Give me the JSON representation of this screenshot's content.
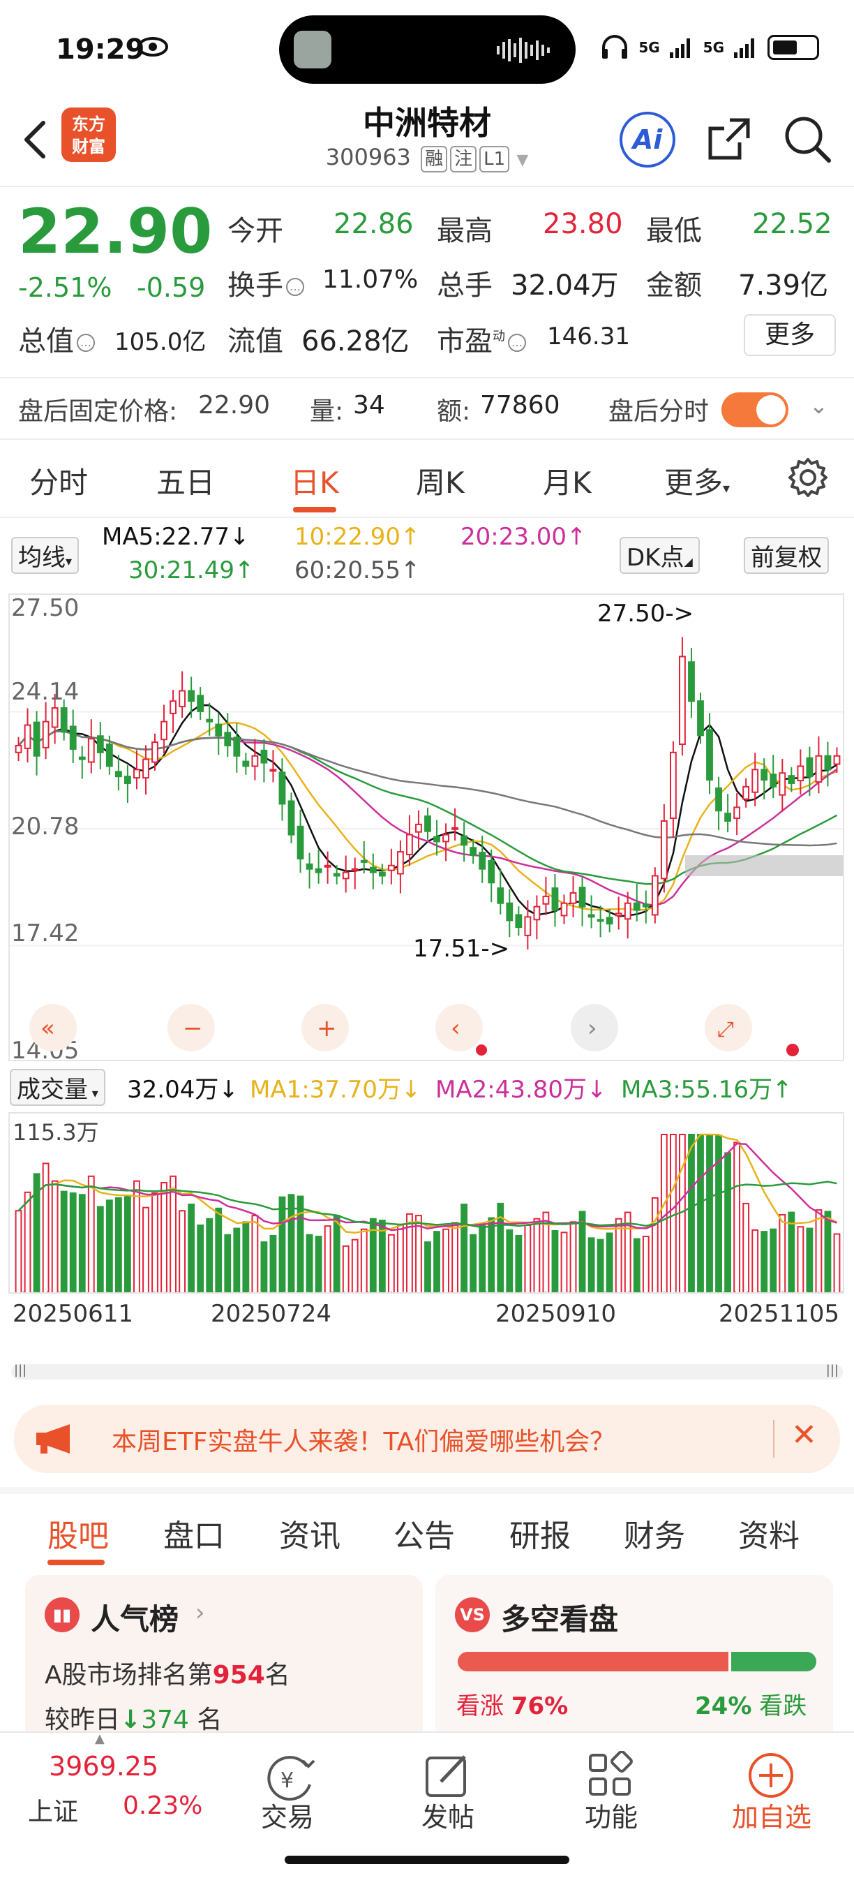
{
  "status": {
    "time": "19:29",
    "net1": "5G",
    "net2": "5G"
  },
  "header": {
    "logo_line1": "东方",
    "logo_line2": "财富",
    "name": "中洲特材",
    "code": "300963",
    "tags": [
      "融",
      "注",
      "L1"
    ],
    "ai_label": "Ai"
  },
  "quote": {
    "price": "22.90",
    "change_pct": "-2.51%",
    "change_abs": "-0.59",
    "open_label": "今开",
    "open": "22.86",
    "high_label": "最高",
    "high": "23.80",
    "low_label": "最低",
    "low": "22.52",
    "turnover_label": "换手",
    "turnover": "11.07%",
    "volume_label": "总手",
    "volume": "32.04万",
    "amount_label": "金额",
    "amount": "7.39亿",
    "mktcap_label": "总值",
    "mktcap": "105.0亿",
    "float_label": "流值",
    "float": "66.28亿",
    "pe_label": "市盈",
    "pe_sup": "动",
    "pe": "146.31",
    "more": "更多"
  },
  "after_hours": {
    "price_label": "盘后固定价格:",
    "price": "22.90",
    "vol_label": "量:",
    "vol": "34",
    "amt_label": "额:",
    "amt": "77860",
    "toggle_label": "盘后分时"
  },
  "period_tabs": [
    "分时",
    "五日",
    "日K",
    "周K",
    "月K",
    "更多"
  ],
  "ma_legend": {
    "selector": "均线",
    "ma5": "MA5:22.77↓",
    "ma10": "10:22.90↑",
    "ma20": "20:23.00↑",
    "ma30": "30:21.49↑",
    "ma60": "60:20.55↑",
    "dk": "DK点",
    "adjust": "前复权"
  },
  "colors": {
    "up": "#e2233a",
    "down": "#2a9b3c",
    "accent": "#e8512a",
    "ma5": "#111111",
    "ma10": "#e8b21a",
    "ma20": "#cc2f9a",
    "ma30": "#2a9b3c",
    "ma60": "#777777"
  },
  "kchart": {
    "y_labels": [
      "27.50",
      "24.14",
      "20.78",
      "17.42",
      "14.05"
    ],
    "high_marker": "27.50->",
    "low_marker": "17.51->"
  },
  "volume_bar": {
    "selector": "成交量",
    "vol": "32.04万↓",
    "ma1": "MA1:37.70万↓",
    "ma2": "MA2:43.80万↓",
    "ma3": "MA3:55.16万↑",
    "max_label": "115.3万"
  },
  "dates": [
    "20250611",
    "20250724",
    "20250910",
    "20251105"
  ],
  "banner": {
    "text": "本周ETF实盘牛人来袭！TA们偏爱哪些机会？"
  },
  "content_tabs": [
    "股吧",
    "盘口",
    "资讯",
    "公告",
    "研报",
    "财务",
    "资料"
  ],
  "rank_card": {
    "title": "人气榜",
    "line1_prefix": "A股市场排名第",
    "rank": "954",
    "line1_suffix": "名",
    "line2_prefix": "较昨日",
    "delta": "374",
    "line2_suffix": "名"
  },
  "vs_card": {
    "badge": "VS",
    "title": "多空看盘",
    "bull_label": "看涨",
    "bull_pct": "76%",
    "bear_pct": "24%",
    "bear_label": "看跌",
    "bull_fraction": 0.76
  },
  "bottom_nav": {
    "index_value": "3969.25",
    "index_name": "上证",
    "index_change": "0.23%",
    "items": [
      "交易",
      "发帖",
      "功能",
      "加自选"
    ]
  },
  "chart_data": {
    "type": "candlestick",
    "x_range": [
      "20250611",
      "20251110"
    ],
    "ylim": [
      14.05,
      27.5
    ],
    "highlighted": {
      "high": 27.5,
      "low": 17.51
    },
    "close_approx": [
      23.2,
      23.8,
      22.9,
      23.9,
      24.3,
      23.6,
      23.1,
      22.8,
      23.4,
      23.0,
      22.6,
      22.3,
      22.1,
      22.5,
      22.8,
      23.3,
      23.9,
      24.5,
      24.8,
      24.5,
      24.2,
      23.9,
      23.5,
      23.2,
      22.9,
      22.6,
      22.9,
      22.7,
      22.5,
      21.5,
      20.6,
      19.9,
      19.6,
      19.5,
      19.7,
      19.4,
      19.5,
      19.6,
      19.8,
      19.5,
      19.4,
      19.7,
      20.1,
      20.6,
      20.9,
      20.7,
      20.4,
      20.6,
      20.8,
      20.3,
      20.0,
      19.6,
      19.2,
      18.6,
      18.1,
      17.9,
      18.2,
      18.5,
      18.8,
      18.4,
      18.6,
      18.9,
      18.5,
      18.2,
      18.1,
      18.0,
      18.3,
      18.6,
      18.4,
      18.5,
      19.4,
      21.0,
      23.0,
      25.8,
      24.5,
      23.5,
      22.2,
      21.3,
      21.0,
      21.4,
      22.0,
      22.5,
      22.2,
      22.0,
      22.4,
      22.1,
      22.6,
      22.3,
      22.9,
      22.5,
      22.9
    ],
    "volume_max": "115.3万"
  }
}
